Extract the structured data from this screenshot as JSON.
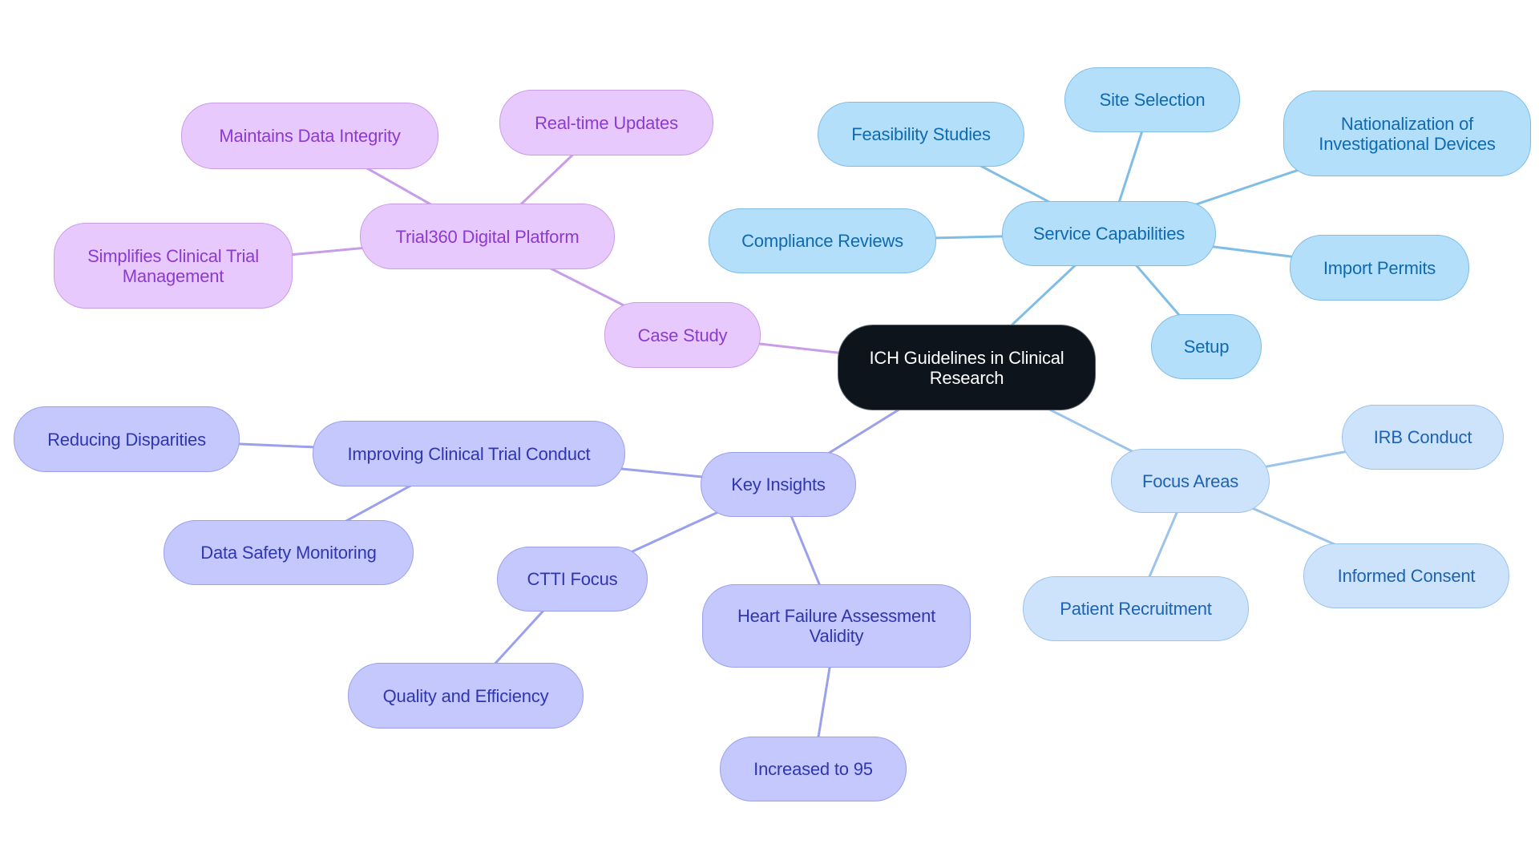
{
  "title": "ICH Guidelines in Clinical Research",
  "colors": {
    "root_fill": "#0d141b",
    "purple_branch": "#c99ce8",
    "sky_branch": "#7fbde6",
    "indigo_branch": "#9aa0ec",
    "pale_branch": "#9cc3ea"
  },
  "nodes": {
    "root": {
      "label": "ICH Guidelines in Clinical Research"
    },
    "case_study": {
      "label": "Case Study"
    },
    "trial360": {
      "label": "Trial360 Digital Platform"
    },
    "maintains": {
      "label": "Maintains Data Integrity"
    },
    "realtime": {
      "label": "Real-time Updates"
    },
    "simplifies": {
      "label": "Simplifies Clinical Trial Management"
    },
    "service": {
      "label": "Service Capabilities"
    },
    "feasibility": {
      "label": "Feasibility Studies"
    },
    "site_selection": {
      "label": "Site Selection"
    },
    "nationalization": {
      "label": "Nationalization of Investigational Devices"
    },
    "compliance": {
      "label": "Compliance Reviews"
    },
    "import_permits": {
      "label": "Import Permits"
    },
    "setup": {
      "label": "Setup"
    },
    "key_insights": {
      "label": "Key Insights"
    },
    "improving": {
      "label": "Improving Clinical Trial Conduct"
    },
    "reducing": {
      "label": "Reducing Disparities"
    },
    "data_safety": {
      "label": "Data Safety Monitoring"
    },
    "ctti": {
      "label": "CTTI Focus"
    },
    "quality": {
      "label": "Quality and Efficiency"
    },
    "heart_failure": {
      "label": "Heart Failure Assessment Validity"
    },
    "increased": {
      "label": "Increased to 95"
    },
    "focus_areas": {
      "label": "Focus Areas"
    },
    "irb": {
      "label": "IRB Conduct"
    },
    "informed": {
      "label": "Informed Consent"
    },
    "patient": {
      "label": "Patient Recruitment"
    }
  },
  "edges": [
    {
      "from": "root",
      "to": "case_study",
      "branch": "purple"
    },
    {
      "from": "case_study",
      "to": "trial360",
      "branch": "purple"
    },
    {
      "from": "trial360",
      "to": "maintains",
      "branch": "purple"
    },
    {
      "from": "trial360",
      "to": "realtime",
      "branch": "purple"
    },
    {
      "from": "trial360",
      "to": "simplifies",
      "branch": "purple"
    },
    {
      "from": "root",
      "to": "service",
      "branch": "sky"
    },
    {
      "from": "service",
      "to": "feasibility",
      "branch": "sky"
    },
    {
      "from": "service",
      "to": "site_selection",
      "branch": "sky"
    },
    {
      "from": "service",
      "to": "nationalization",
      "branch": "sky"
    },
    {
      "from": "service",
      "to": "compliance",
      "branch": "sky"
    },
    {
      "from": "service",
      "to": "import_permits",
      "branch": "sky"
    },
    {
      "from": "service",
      "to": "setup",
      "branch": "sky"
    },
    {
      "from": "root",
      "to": "key_insights",
      "branch": "indigo"
    },
    {
      "from": "key_insights",
      "to": "improving",
      "branch": "indigo"
    },
    {
      "from": "improving",
      "to": "reducing",
      "branch": "indigo"
    },
    {
      "from": "improving",
      "to": "data_safety",
      "branch": "indigo"
    },
    {
      "from": "key_insights",
      "to": "ctti",
      "branch": "indigo"
    },
    {
      "from": "ctti",
      "to": "quality",
      "branch": "indigo"
    },
    {
      "from": "key_insights",
      "to": "heart_failure",
      "branch": "indigo"
    },
    {
      "from": "heart_failure",
      "to": "increased",
      "branch": "indigo"
    },
    {
      "from": "root",
      "to": "focus_areas",
      "branch": "pale"
    },
    {
      "from": "focus_areas",
      "to": "irb",
      "branch": "pale"
    },
    {
      "from": "focus_areas",
      "to": "informed",
      "branch": "pale"
    },
    {
      "from": "focus_areas",
      "to": "patient",
      "branch": "pale"
    }
  ]
}
